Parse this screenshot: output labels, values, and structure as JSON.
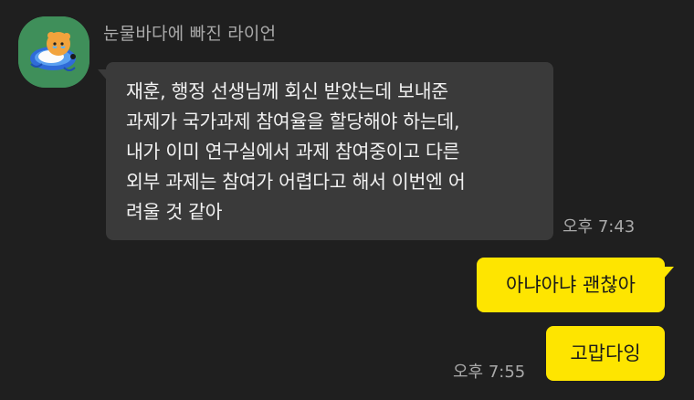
{
  "colors": {
    "background": "#1f1f1f",
    "incoming_bubble": "#3a3a3a",
    "outgoing_bubble": "#fee500",
    "muted_text": "#a9a9a9"
  },
  "incoming": {
    "sender": "눈물바다에 빠진 라이언",
    "avatar_icon": "profile-avatar-icon",
    "lines": [
      "재훈, 행정 선생님께 회신 받았는데 보내준",
      "과제가 국가과제 참여율을 할당해야 하는데,",
      "내가 이미 연구실에서 과제 참여중이고 다른",
      "외부 과제는 참여가 어렵다고 해서 이번엔 어",
      "려울 것 같아"
    ],
    "time": "오후 7:43"
  },
  "outgoing": [
    {
      "text": "아냐아냐 괜찮아"
    },
    {
      "text": "고맙다잉",
      "time": "오후 7:55"
    }
  ]
}
